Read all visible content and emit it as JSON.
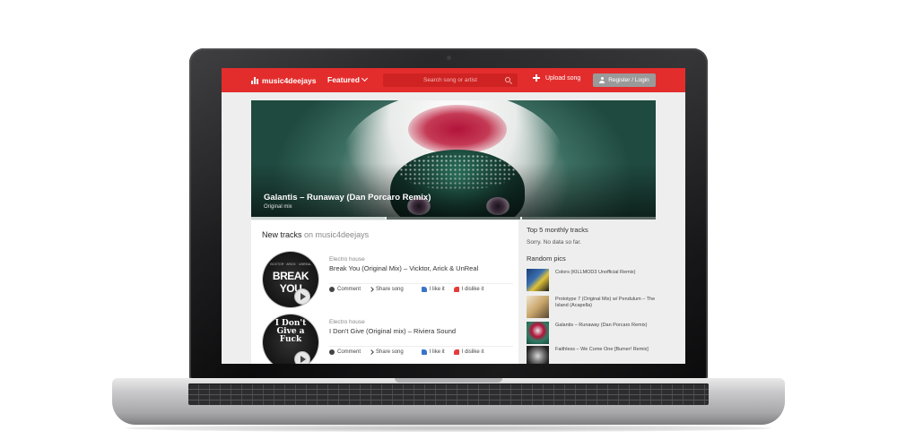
{
  "site": {
    "logo_text": "music4deejays",
    "nav_featured": "Featured",
    "search_placeholder": "Search song or artist",
    "upload_label": "Upload song",
    "login_label": "Register / Login",
    "brand_color": "#e32d2d"
  },
  "hero": {
    "title": "Galantis – Runaway (Dan Porcaro Remix)",
    "subtitle": "Original mix"
  },
  "new_tracks": {
    "title": "New tracks",
    "title_accent": "on music4deejays",
    "items": [
      {
        "cover_text": "BREAK YOU",
        "genre": "Electro house",
        "title": "Break You (Original Mix) – Vicktor, Arick & UnReal",
        "actions": {
          "comment": "Comment",
          "share": "Share song",
          "like": "I like it",
          "dislike": "I dislike it"
        }
      },
      {
        "cover_text": "I Don't Give a Fuck",
        "genre": "Electro house",
        "title": "I Don't Give (Original mix) – Riviera Sound",
        "actions": {
          "comment": "Comment",
          "share": "Share song",
          "like": "I like it",
          "dislike": "I dislike it"
        }
      }
    ]
  },
  "sidebar": {
    "top_title": "Top 5 monthly tracks",
    "top_empty": "Sorry. No data so far.",
    "pics_title": "Random pics",
    "pics": [
      {
        "label": "Colors (KILLMOD3 Unofficial Remix)",
        "color": "#3a6fb0"
      },
      {
        "label": "Prototype 7 (Original Mix) w/ Pendulum – The Island (Acapella)",
        "color": "#c9a66b"
      },
      {
        "label": "Galantis – Runaway (Dan Porcaro Remix)",
        "color": "#2f7c65"
      },
      {
        "label": "Faithless – We Come One [Bumer! Remix]",
        "color": "#222222"
      }
    ]
  }
}
